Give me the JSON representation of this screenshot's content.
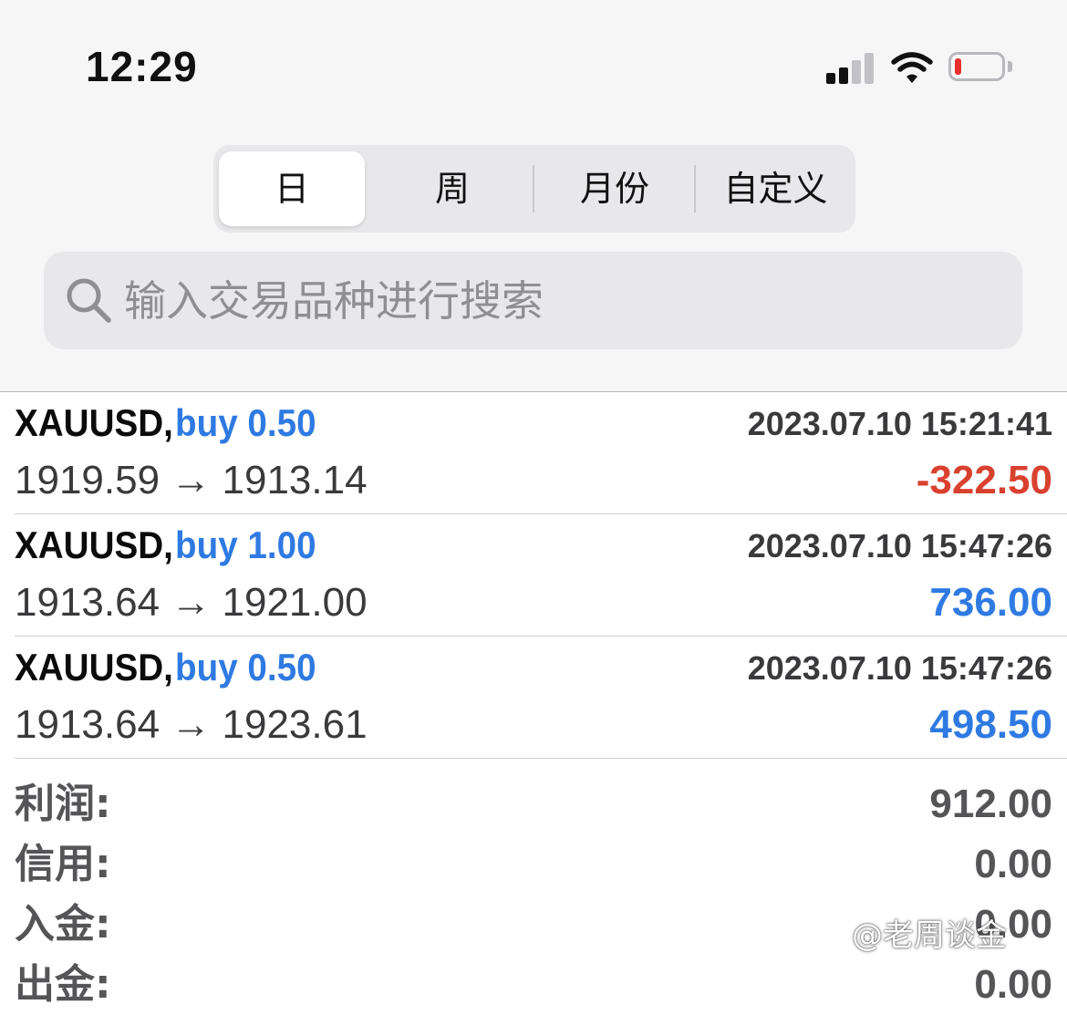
{
  "status_bar": {
    "time": "12:29",
    "icons": [
      "signal-icon",
      "wifi-icon",
      "battery-icon"
    ],
    "battery_color": "#e5302b"
  },
  "period_tabs": {
    "selected": 0,
    "items": [
      {
        "label": "日"
      },
      {
        "label": "周"
      },
      {
        "label": "月份"
      },
      {
        "label": "自定义"
      }
    ]
  },
  "search": {
    "placeholder": "输入交易品种进行搜索",
    "value": ""
  },
  "trades": [
    {
      "symbol": "XAUUSD,",
      "type": "buy 0.50",
      "time": "2023.07.10 15:21:41",
      "prices": "1919.59 → 1913.14",
      "profit": "-322.50",
      "profit_color": "#d9412f"
    },
    {
      "symbol": "XAUUSD,",
      "type": "buy 1.00",
      "time": "2023.07.10 15:47:26",
      "prices": "1913.64 → 1921.00",
      "profit": "736.00",
      "profit_color": "#2f7ae2"
    },
    {
      "symbol": "XAUUSD,",
      "type": "buy 0.50",
      "time": "2023.07.10 15:47:26",
      "prices": "1913.64 → 1923.61",
      "profit": "498.50",
      "profit_color": "#2f7ae2"
    }
  ],
  "summary": [
    {
      "label": "利润:",
      "value": "912.00"
    },
    {
      "label": "信用:",
      "value": "0.00"
    },
    {
      "label": "入金:",
      "value": "0.00"
    },
    {
      "label": "出金:",
      "value": "0.00"
    }
  ],
  "watermark": "@老周谈金",
  "colors": {
    "buy_blue": "#2f7ae2",
    "loss_red": "#d9412f"
  }
}
